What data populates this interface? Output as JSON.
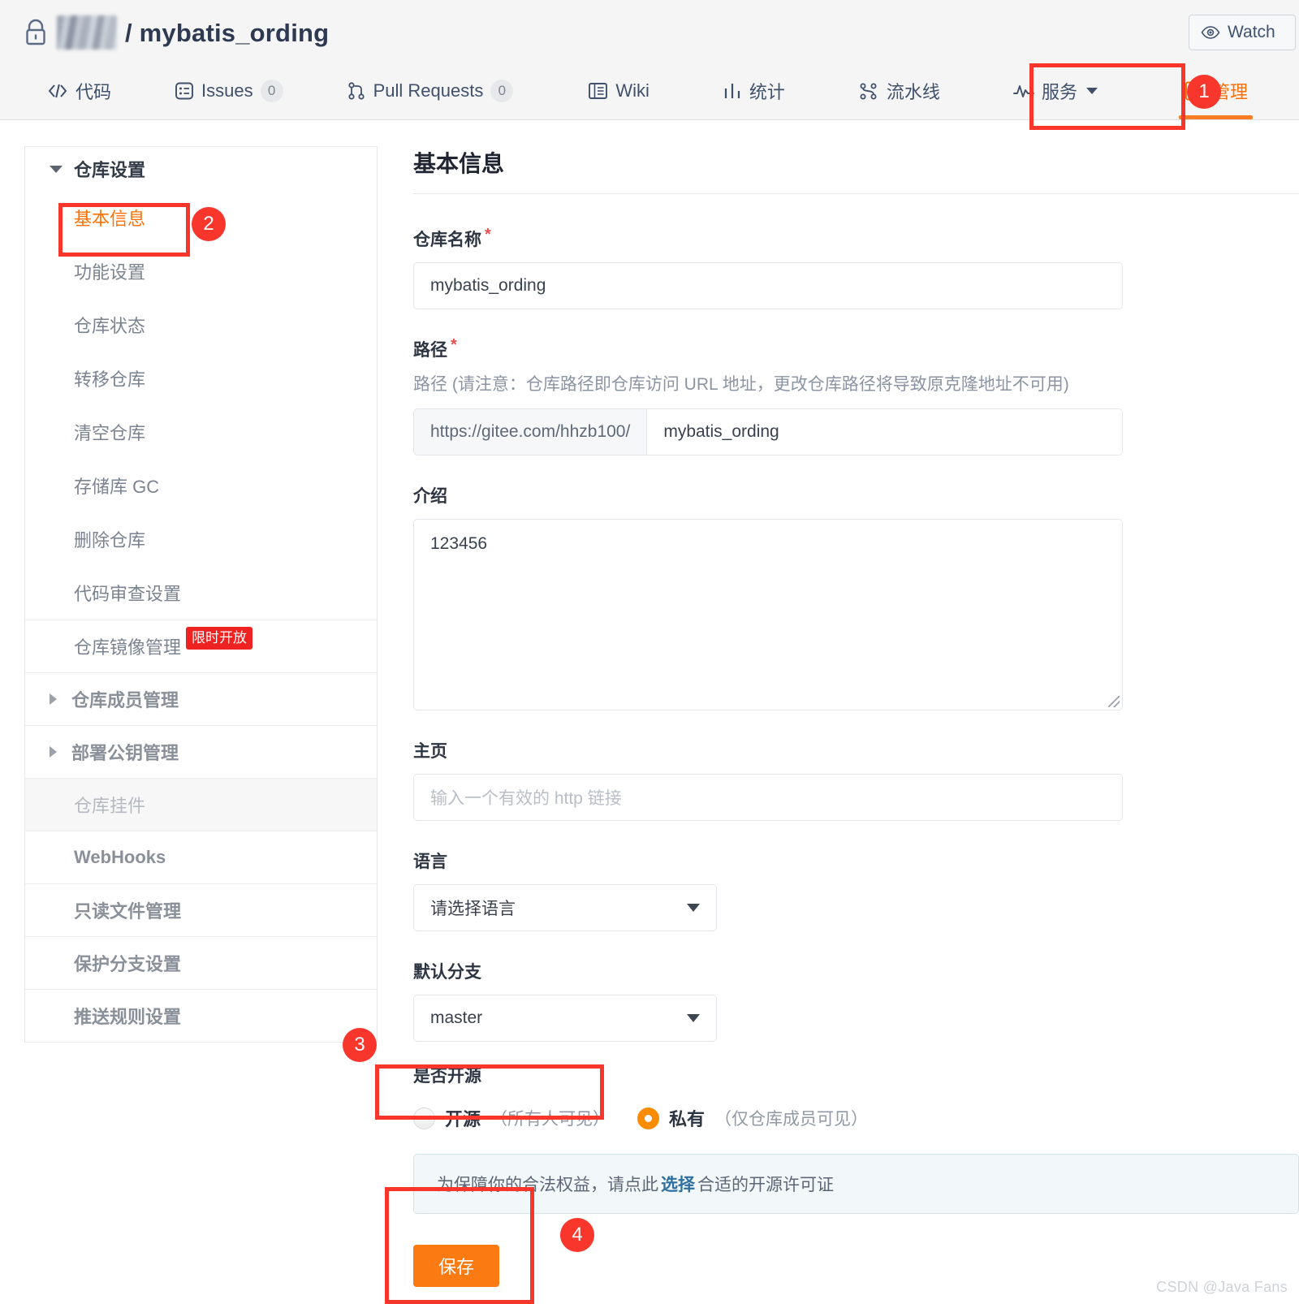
{
  "header": {
    "lock_icon": "lock-icon",
    "org_name_redacted": "",
    "separator": "/",
    "repo_name": "mybatis_ording",
    "watch_label": "Watch",
    "watch_icon": "eye-icon"
  },
  "nav": {
    "items": [
      {
        "label": "代码",
        "icon": "code-icon",
        "count": null,
        "active": false,
        "caret": false
      },
      {
        "label": "Issues",
        "icon": "issues-icon",
        "count": "0",
        "active": false,
        "caret": false
      },
      {
        "label": "Pull Requests",
        "icon": "pull-request-icon",
        "count": "0",
        "active": false,
        "caret": false
      },
      {
        "label": "Wiki",
        "icon": "wiki-icon",
        "count": null,
        "active": false,
        "caret": false
      },
      {
        "label": "统计",
        "icon": "chart-icon",
        "count": null,
        "active": false,
        "caret": false
      },
      {
        "label": "流水线",
        "icon": "pipeline-icon",
        "count": null,
        "active": false,
        "caret": false
      },
      {
        "label": "服务",
        "icon": "service-icon",
        "count": null,
        "active": false,
        "caret": true
      },
      {
        "label": "管理",
        "icon": "manage-icon",
        "count": null,
        "active": true,
        "caret": false
      }
    ]
  },
  "sidebar": {
    "group_title": "仓库设置",
    "sub_items": [
      {
        "label": "基本信息",
        "current": true
      },
      {
        "label": "功能设置",
        "current": false
      },
      {
        "label": "仓库状态",
        "current": false
      },
      {
        "label": "转移仓库",
        "current": false
      },
      {
        "label": "清空仓库",
        "current": false
      },
      {
        "label": "存储库 GC",
        "current": false
      },
      {
        "label": "删除仓库",
        "current": false
      },
      {
        "label": "代码审查设置",
        "current": false
      }
    ],
    "rows": [
      {
        "label": "仓库镜像管理",
        "tag": "限时开放",
        "arrow": false,
        "muted": false,
        "bold": false
      },
      {
        "label": "仓库成员管理",
        "tag": null,
        "arrow": true,
        "muted": false,
        "bold": true
      },
      {
        "label": "部署公钥管理",
        "tag": null,
        "arrow": true,
        "muted": false,
        "bold": true
      },
      {
        "label": "仓库挂件",
        "tag": null,
        "arrow": false,
        "muted": true,
        "bold": false
      },
      {
        "label": "WebHooks",
        "tag": null,
        "arrow": false,
        "muted": false,
        "bold": true
      },
      {
        "label": "只读文件管理",
        "tag": null,
        "arrow": false,
        "muted": false,
        "bold": true
      },
      {
        "label": "保护分支设置",
        "tag": null,
        "arrow": false,
        "muted": false,
        "bold": true
      },
      {
        "label": "推送规则设置",
        "tag": null,
        "arrow": false,
        "muted": false,
        "bold": true
      }
    ]
  },
  "main": {
    "page_title": "基本信息",
    "repo_name_field": {
      "label": "仓库名称",
      "required_mark": "*",
      "value": "mybatis_ording"
    },
    "path_field": {
      "label": "路径",
      "required_mark": "*",
      "hint": "路径 (请注意：仓库路径即仓库访问 URL 地址，更改仓库路径将导致原克隆地址不可用)",
      "prefix": "https://gitee.com/hhzb100/",
      "value": "mybatis_ording"
    },
    "intro_field": {
      "label": "介绍",
      "value": "123456"
    },
    "homepage_field": {
      "label": "主页",
      "value": "",
      "placeholder": "输入一个有效的 http 链接"
    },
    "language_field": {
      "label": "语言",
      "selected": "请选择语言"
    },
    "branch_field": {
      "label": "默认分支",
      "selected": "master"
    },
    "open_source_field": {
      "label": "是否开源",
      "options": [
        {
          "name": "开源",
          "note": "（所有人可见）",
          "selected": false
        },
        {
          "name": "私有",
          "note": "（仅仓库成员可见）",
          "selected": true
        }
      ]
    },
    "license_notice": {
      "text_before": "为保障你的合法权益，请点此",
      "link": "选择",
      "text_after": "合适的开源许可证"
    },
    "save_label": "保存"
  },
  "annotations": {
    "badges": [
      "1",
      "2",
      "3",
      "4"
    ]
  },
  "watermark": "CSDN @Java Fans",
  "colors": {
    "accent_orange": "#ff7002",
    "annotation_red": "#f9362c",
    "save_orange": "#fb7a12",
    "tag_red": "#ef2222",
    "notice_bg": "#f2f8f9"
  }
}
